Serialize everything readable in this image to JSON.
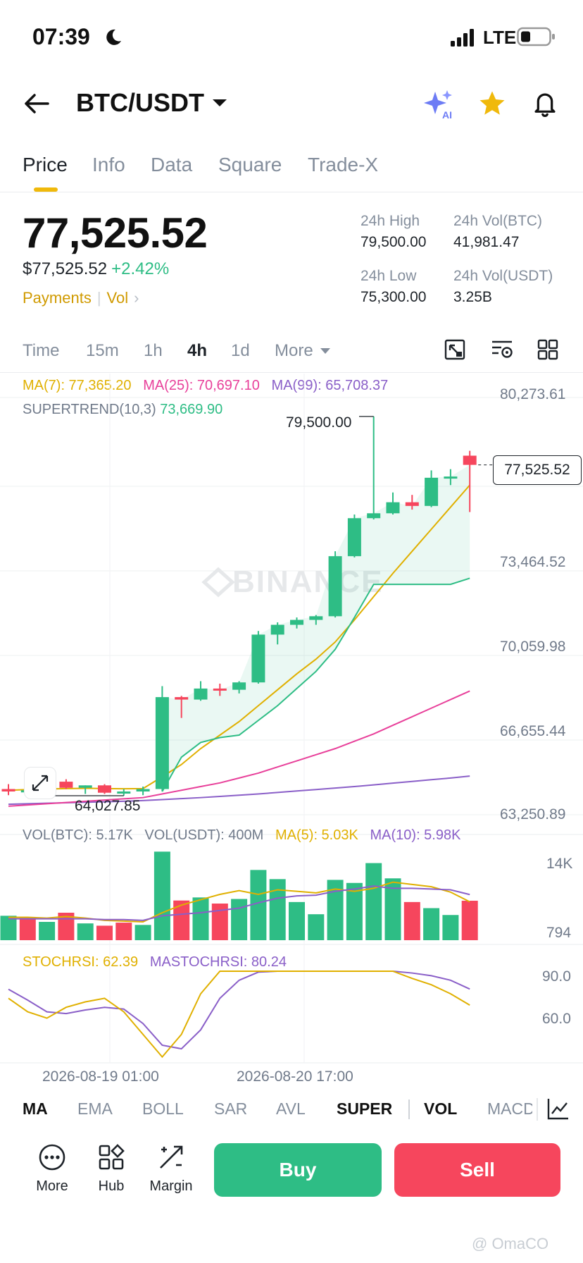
{
  "status": {
    "time": "07:39",
    "network": "LTE"
  },
  "header": {
    "pair": "BTC/USDT"
  },
  "tabs": [
    {
      "label": "Price",
      "active": true
    },
    {
      "label": "Info"
    },
    {
      "label": "Data"
    },
    {
      "label": "Square"
    },
    {
      "label": "Trade-X"
    }
  ],
  "ticker": {
    "price": "77,525.52",
    "usd_price": "$77,525.52",
    "change": "+2.42%",
    "payments": "Payments",
    "vol": "Vol",
    "high_label": "24h High",
    "high_value": "79,500.00",
    "low_label": "24h Low",
    "low_value": "75,300.00",
    "vol_btc_label": "24h Vol(BTC)",
    "vol_btc_value": "41,981.47",
    "vol_usdt_label": "24h Vol(USDT)",
    "vol_usdt_value": "3.25B"
  },
  "intervals": [
    "Time",
    "15m",
    "1h",
    "4h",
    "1d",
    "More"
  ],
  "active_interval": "4h",
  "indicators_text": {
    "ma7_label": "MA(7): 77,365.20",
    "ma25_label": "MA(25): 70,697.10",
    "ma99_label": "MA(99): 65,708.37",
    "supertrend_label": "SUPERTREND(10,3)",
    "supertrend_value": "73,669.90",
    "high_marker": "79,500.00",
    "low_marker": "64,027.85",
    "last_price_tag": "77,525.52",
    "vol_btc": "VOL(BTC): 5.17K",
    "vol_usdt": "VOL(USDT): 400M",
    "vol_ma5": "MA(5): 5.03K",
    "vol_ma10": "MA(10): 5.98K",
    "stochrsi": "STOCHRSI: 62.39",
    "mastochrsi": "MASTOCHRSI: 80.24"
  },
  "axes": {
    "price_ticks": [
      "80,273.61",
      "73,464.52",
      "70,059.98",
      "66,655.44",
      "63,250.89"
    ],
    "vol_ticks": [
      "14K",
      "794"
    ],
    "rsi_ticks": [
      "90.0",
      "60.0"
    ],
    "time_ticks": [
      "2026-08-19 01:00",
      "2026-08-20 17:00"
    ]
  },
  "indicator_tabs": [
    "MA",
    "EMA",
    "BOLL",
    "SAR",
    "AVL",
    "SUPER",
    "VOL",
    "MACD"
  ],
  "bottom_bar": {
    "more": "More",
    "hub": "Hub",
    "margin": "Margin",
    "buy": "Buy",
    "sell": "Sell"
  },
  "watermark": {
    "brand": "BINANCE",
    "footer": "@ OmaCO"
  },
  "colors": {
    "up": "#2ebd85",
    "down": "#f6465d",
    "accent": "#f0b90b",
    "ma7": "#e0b000",
    "ma25": "#e8409a",
    "ma99": "#8a5fc8",
    "supertrend": "#2ebd85"
  },
  "chart_data": {
    "type": "candlestick",
    "price_axis": [
      63250.89,
      80273.61
    ],
    "candles": [
      {
        "o": 64300,
        "h": 64500,
        "l": 64050,
        "c": 64200
      },
      {
        "o": 64200,
        "h": 64600,
        "l": 64000,
        "c": 64250
      },
      {
        "o": 64250,
        "h": 64500,
        "l": 64050,
        "c": 64400
      },
      {
        "o": 64600,
        "h": 64700,
        "l": 64300,
        "c": 64350
      },
      {
        "o": 64350,
        "h": 64450,
        "l": 64100,
        "c": 64450
      },
      {
        "o": 64450,
        "h": 64500,
        "l": 64100,
        "c": 64150
      },
      {
        "o": 64150,
        "h": 64300,
        "l": 64028,
        "c": 64200
      },
      {
        "o": 64200,
        "h": 64400,
        "l": 64050,
        "c": 64300
      },
      {
        "o": 64300,
        "h": 68500,
        "l": 64200,
        "c": 68050
      },
      {
        "o": 68050,
        "h": 68100,
        "l": 67200,
        "c": 67950
      },
      {
        "o": 67950,
        "h": 68700,
        "l": 67900,
        "c": 68400
      },
      {
        "o": 68400,
        "h": 68600,
        "l": 68100,
        "c": 68350
      },
      {
        "o": 68350,
        "h": 68700,
        "l": 68200,
        "c": 68650
      },
      {
        "o": 68650,
        "h": 70750,
        "l": 68600,
        "c": 70600
      },
      {
        "o": 70600,
        "h": 71100,
        "l": 70200,
        "c": 71000
      },
      {
        "o": 71000,
        "h": 71300,
        "l": 70850,
        "c": 71200
      },
      {
        "o": 71200,
        "h": 71400,
        "l": 71000,
        "c": 71350
      },
      {
        "o": 71350,
        "h": 74000,
        "l": 71300,
        "c": 73800
      },
      {
        "o": 73800,
        "h": 75500,
        "l": 73750,
        "c": 75350
      },
      {
        "o": 75350,
        "h": 79500,
        "l": 75300,
        "c": 75550
      },
      {
        "o": 75550,
        "h": 76400,
        "l": 75500,
        "c": 76000
      },
      {
        "o": 76000,
        "h": 76300,
        "l": 75700,
        "c": 75850
      },
      {
        "o": 75850,
        "h": 77300,
        "l": 75800,
        "c": 77000
      },
      {
        "o": 77000,
        "h": 77350,
        "l": 76700,
        "c": 77050
      },
      {
        "o": 77900,
        "h": 78100,
        "l": 75600,
        "c": 77525.52
      }
    ],
    "ma7": [
      64250,
      64280,
      64300,
      64320,
      64330,
      64320,
      64310,
      64320,
      64800,
      65300,
      65950,
      66500,
      67050,
      67700,
      68350,
      69000,
      69600,
      70300,
      71200,
      72150,
      73100,
      74000,
      74900,
      75800,
      76700
    ],
    "ma25": [
      63600,
      63650,
      63700,
      63750,
      63800,
      63850,
      63900,
      63950,
      64100,
      64250,
      64400,
      64550,
      64750,
      64950,
      65200,
      65450,
      65700,
      65950,
      66250,
      66550,
      66900,
      67250,
      67600,
      67950,
      68300
    ],
    "ma99": [
      63680,
      63700,
      63720,
      63740,
      63760,
      63780,
      63800,
      63830,
      63870,
      63910,
      63950,
      64000,
      64050,
      64100,
      64160,
      64220,
      64280,
      64340,
      64400,
      64470,
      64540,
      64610,
      64680,
      64750,
      64830
    ],
    "supertrend": [
      null,
      null,
      null,
      null,
      null,
      null,
      null,
      null,
      64200,
      65600,
      66200,
      66400,
      66500,
      67100,
      67700,
      68400,
      69100,
      70000,
      71300,
      72650,
      72650,
      72650,
      72650,
      72650,
      72900
    ],
    "volume": [
      3.2,
      3.0,
      2.4,
      3.6,
      2.2,
      1.9,
      2.3,
      2.0,
      11.6,
      5.2,
      5.6,
      4.8,
      5.4,
      9.2,
      8.0,
      5.0,
      3.4,
      7.9,
      7.5,
      10.1,
      8.1,
      5.0,
      4.2,
      3.3,
      5.17
    ],
    "volume_up": [
      true,
      false,
      true,
      false,
      true,
      false,
      false,
      true,
      true,
      false,
      true,
      false,
      true,
      true,
      true,
      true,
      true,
      true,
      true,
      true,
      true,
      false,
      true,
      true,
      false
    ],
    "vol_ma5": [
      3.0,
      3.0,
      2.9,
      3.1,
      2.9,
      2.6,
      2.5,
      2.4,
      3.6,
      4.6,
      5.3,
      6.0,
      6.5,
      6.0,
      6.6,
      6.4,
      6.2,
      6.7,
      6.4,
      6.8,
      7.6,
      7.3,
      7.0,
      6.3,
      5.03
    ],
    "vol_ma10": [
      2.8,
      2.8,
      2.8,
      2.8,
      2.8,
      2.7,
      2.7,
      2.6,
      3.2,
      3.4,
      3.6,
      3.9,
      4.2,
      4.9,
      5.5,
      5.8,
      5.9,
      6.4,
      6.7,
      7.1,
      6.8,
      6.8,
      6.7,
      6.6,
      5.98
    ],
    "stochrsi": [
      70,
      55,
      48,
      60,
      66,
      70,
      55,
      30,
      5,
      30,
      75,
      100,
      100,
      100,
      100,
      100,
      100,
      100,
      100,
      100,
      100,
      92,
      85,
      75,
      62.39
    ],
    "mastochrsi": [
      80,
      68,
      55,
      53,
      57,
      60,
      58,
      42,
      18,
      14,
      35,
      70,
      90,
      99,
      100,
      100,
      100,
      100,
      100,
      100,
      100,
      98,
      95,
      90,
      80.24
    ]
  }
}
